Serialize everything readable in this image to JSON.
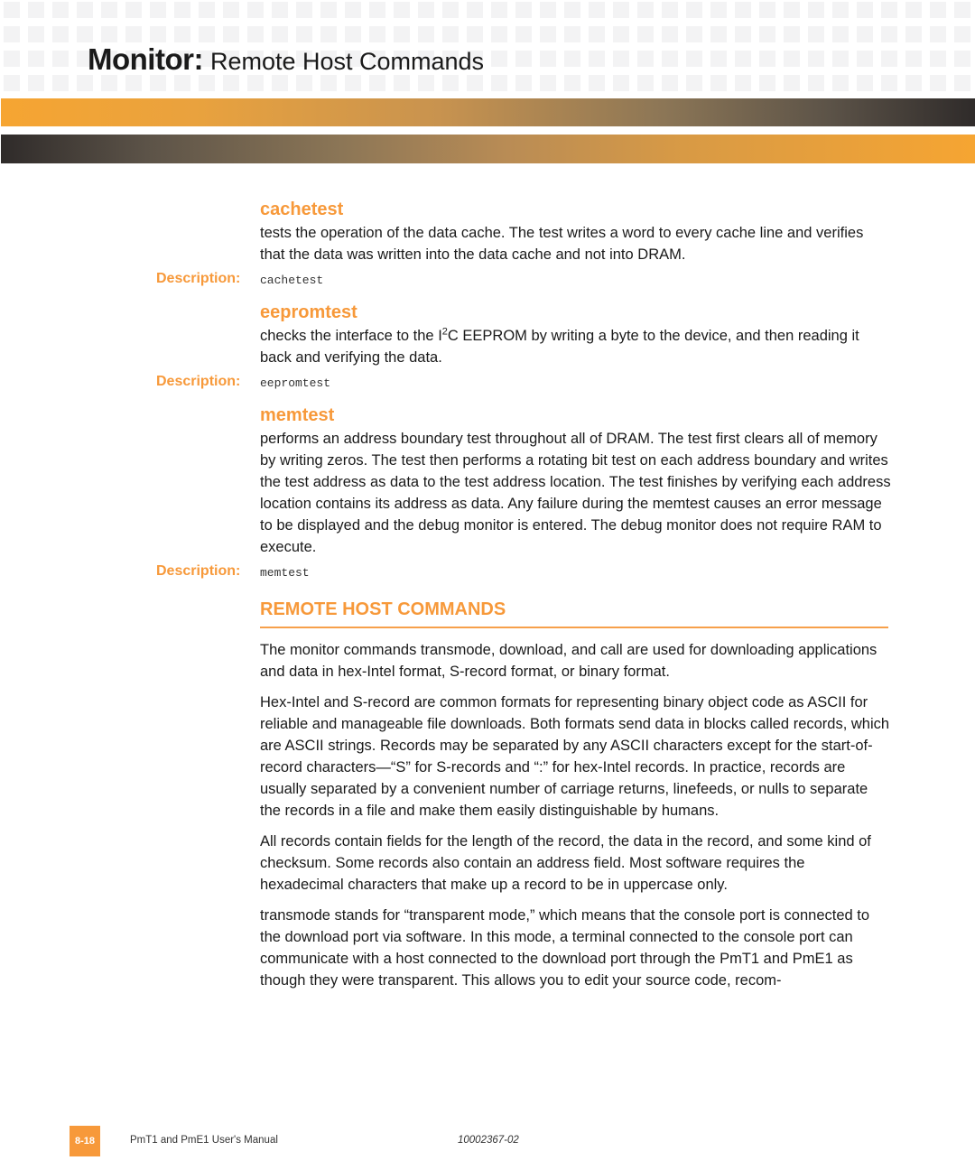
{
  "header": {
    "title_bold": "Monitor:",
    "title_light": "Remote Host Commands"
  },
  "commands": [
    {
      "name": "cachetest",
      "body": "tests the operation of the data cache. The test writes a word to every cache line and verifies that the data was written into the data cache and not into DRAM.",
      "desc_label": "Description:",
      "desc_code": "cachetest"
    },
    {
      "name": "eepromtest",
      "body_before": "checks the interface to the I",
      "body_sup": "2",
      "body_after": "C EEPROM by writing a byte to the device, and then reading it back and verifying the data.",
      "desc_label": "Description:",
      "desc_code": "eepromtest"
    },
    {
      "name": "memtest",
      "body": "performs an address boundary test throughout all of DRAM. The test first clears all of memory by writing zeros. The test then performs a rotating bit test on each address boundary and writes the test address as data to the test address location. The test finishes by verifying each address location contains its address as data. Any failure during the memtest causes an error message to be displayed and the debug monitor is entered. The debug monitor does not require RAM to execute.",
      "desc_label": "Description:",
      "desc_code": "memtest"
    }
  ],
  "section": {
    "title": "REMOTE HOST COMMANDS",
    "paragraphs": [
      "The monitor commands transmode, download, and call are used for downloading applications and data in hex-Intel format, S-record format, or binary format.",
      "Hex-Intel and S-record are common formats for representing binary object code as ASCII for reliable and manageable file downloads. Both formats send data in blocks called records, which are ASCII strings. Records may be separated by any ASCII characters except for the start-of-record characters—“S” for S-records and “:” for hex-Intel records. In practice, records are usually separated by a convenient number of carriage returns, linefeeds, or nulls to separate the records in a file and make them easily distinguishable by humans.",
      "All records contain fields for the length of the record, the data in the record, and some kind of checksum. Some records also contain an address field. Most software requires the hexadecimal characters that make up a record to be in uppercase only.",
      "transmode stands for “transparent mode,” which means that the console port is connected to the download port via software. In this mode, a terminal connected to the console port can communicate with a host connected to the download port through the PmT1 and PmE1 as though they were transparent. This allows you to edit your source code, recom-"
    ]
  },
  "footer": {
    "page_number": "8-18",
    "manual_title": "PmT1 and PmE1 User's Manual",
    "doc_number": "10002367-02"
  },
  "colors": {
    "accent": "#f7993a",
    "text": "#1a1a1a"
  }
}
